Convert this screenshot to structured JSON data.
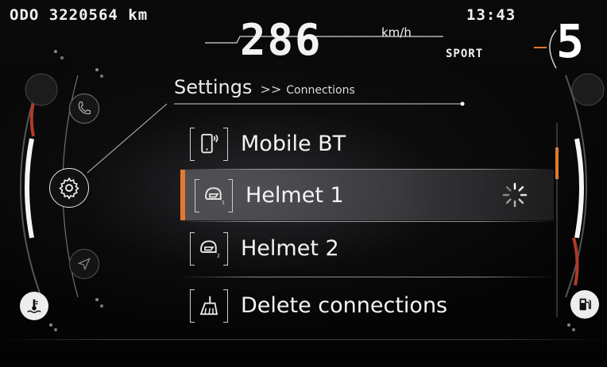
{
  "status": {
    "odometer": "ODO 3220564 km",
    "clock": "13:43",
    "speed": "286",
    "speed_unit": "km/h",
    "riding_mode": "SPORT",
    "gear": "5"
  },
  "breadcrumb": {
    "title": "Settings",
    "separator": ">>",
    "subtitle": "Connections"
  },
  "menu": {
    "items": [
      {
        "label": "Mobile BT",
        "icon": "mobile-bluetooth-icon",
        "selected": false
      },
      {
        "label": "Helmet 1",
        "icon": "helmet-1-icon",
        "selected": true,
        "status": "loading-spinner"
      },
      {
        "label": "Helmet 2",
        "icon": "helmet-2-icon",
        "selected": false
      },
      {
        "label": "Delete connections",
        "icon": "broom-icon",
        "selected": false
      }
    ]
  },
  "side_nav": {
    "items": [
      "phone-icon",
      "settings-gear-icon",
      "navigation-arrow-icon"
    ]
  },
  "indicators": {
    "left": "coolant-temperature-icon",
    "right": "fuel-pump-icon"
  },
  "colors": {
    "accent": "#e07a2e",
    "text": "#f2f2f2",
    "background": "#050505"
  }
}
